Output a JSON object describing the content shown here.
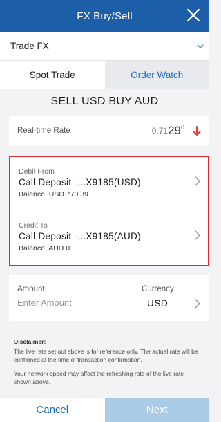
{
  "header": {
    "title": "FX Buy/Sell",
    "close_icon": "close-icon"
  },
  "trade_selector": {
    "label": "Trade FX",
    "icon": "chevron-down-icon"
  },
  "tabs": [
    {
      "label": "Spot Trade",
      "active": true
    },
    {
      "label": "Order Watch",
      "active": false
    }
  ],
  "pair_title": "SELL USD BUY AUD",
  "rate": {
    "label": "Real-time Rate",
    "prefix": "0.71",
    "main": "29",
    "superscript": "0",
    "trend_icon": "arrow-down-icon",
    "trend_color": "#e8392b"
  },
  "debit": {
    "label": "Debit From",
    "account": "Call Deposit -...X9185(USD)",
    "balance": "Balance: USD 770.39"
  },
  "credit": {
    "label": "Credit To",
    "account": "Call Deposit -...X9185(AUD)",
    "balance": "Balance: AUD 0"
  },
  "amount": {
    "label": "Amount",
    "placeholder": "Enter Amount",
    "value": "",
    "currency_label": "Currency",
    "currency_value": "USD"
  },
  "disclaimer": {
    "title": "Disclaimer:",
    "text1": "The live rate set out above is for reference only. The actual rate will be confirmed at the time of transaction confirmation.",
    "text2": "Your network speed may affect the refreshing rate of the live rate shown above."
  },
  "footer": {
    "cancel_label": "Cancel",
    "next_label": "Next"
  },
  "colors": {
    "brand_blue": "#1d5ea8",
    "link_blue": "#1d6fc1",
    "highlight_red": "#e02a2f",
    "next_disabled": "#a9cbe7"
  }
}
